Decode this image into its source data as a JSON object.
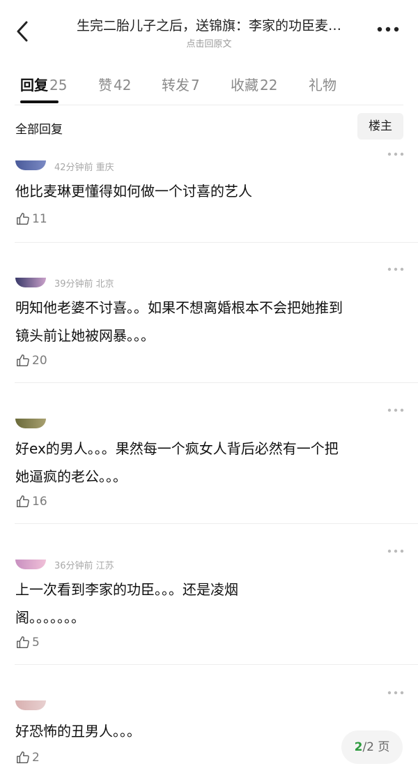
{
  "header": {
    "title": "生完二胎儿子之后，送锦旗：李家的功臣麦…",
    "subtitle": "点击回原文"
  },
  "tabs": [
    {
      "label": "回复",
      "count": "25",
      "active": true
    },
    {
      "label": "赞",
      "count": "42",
      "active": false
    },
    {
      "label": "转发",
      "count": "7",
      "active": false
    },
    {
      "label": "收藏",
      "count": "22",
      "active": false
    },
    {
      "label": "礼物",
      "count": "",
      "active": false
    }
  ],
  "section": {
    "title": "全部回复",
    "op_button": "楼主"
  },
  "comments": [
    {
      "meta": "42分钟前 重庆",
      "lines": [
        "他比麦琳更懂得如何做一个讨喜的艺人"
      ],
      "likes": "11"
    },
    {
      "meta": "39分钟前 北京",
      "lines": [
        "明知他老婆不讨喜。。如果不想离婚根本不会把她推到",
        "镜头前让她被网暴。。。"
      ],
      "likes": "20"
    },
    {
      "meta": "",
      "lines": [
        "好ex的男人。。。果然每一个疯女人背后必然有一个把",
        "她逼疯的老公。。。"
      ],
      "likes": "16"
    },
    {
      "meta": "36分钟前 江苏",
      "lines": [
        "上一次看到李家的功臣。。。还是凌烟",
        "阁。。。。。。。"
      ],
      "likes": "5"
    },
    {
      "meta": "",
      "lines": [
        "好恐怖的丑男人。。。"
      ],
      "likes": "2"
    }
  ],
  "pager": {
    "current": "2",
    "total": "/2 页"
  },
  "colors": {
    "accent_green": "#2e9b3f",
    "text": "#111111",
    "muted": "#8a8a8a"
  }
}
